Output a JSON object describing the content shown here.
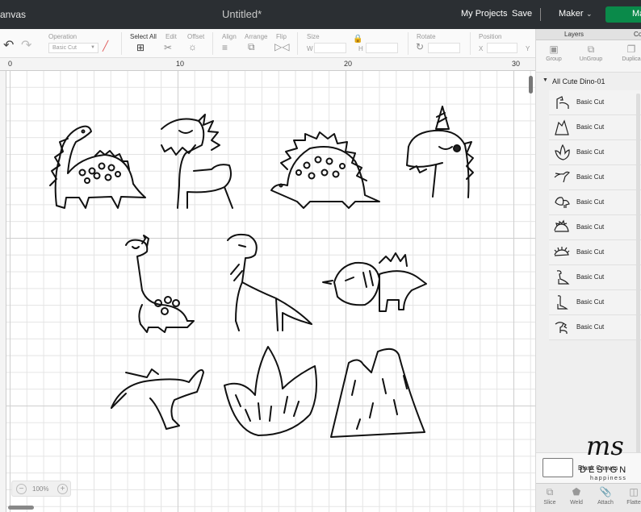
{
  "topbar": {
    "app_title": "anvas",
    "doc_title": "Untitled*",
    "my_projects": "My Projects",
    "save": "Save",
    "machine": "Maker",
    "make": "Ma"
  },
  "toolbar": {
    "operation_label": "Operation",
    "operation_value": "Basic Cut",
    "select_all": "Select All",
    "edit": "Edit",
    "offset": "Offset",
    "align": "Align",
    "arrange": "Arrange",
    "flip": "Flip",
    "size": "Size",
    "size_w": "W",
    "size_h": "H",
    "rotate": "Rotate",
    "position": "Position",
    "pos_x": "X",
    "pos_y": "Y"
  },
  "rulers": {
    "top": [
      "0",
      "10",
      "20",
      "30"
    ]
  },
  "zoom": {
    "value": "100%",
    "minus": "−",
    "plus": "+"
  },
  "panel": {
    "tab_layers": "Layers",
    "tab_color": "Co",
    "actions": [
      "Group",
      "UnGroup",
      "Duplica"
    ],
    "group_name": "All Cute Dino-01",
    "layers": [
      {
        "label": "Basic Cut"
      },
      {
        "label": "Basic Cut"
      },
      {
        "label": "Basic Cut"
      },
      {
        "label": "Basic Cut"
      },
      {
        "label": "Basic Cut"
      },
      {
        "label": "Basic Cut"
      },
      {
        "label": "Basic Cut"
      },
      {
        "label": "Basic Cut"
      },
      {
        "label": "Basic Cut"
      },
      {
        "label": "Basic Cut"
      }
    ],
    "blank_canvas": "Blank Canvas",
    "bottom_actions": [
      "Slice",
      "Weld",
      "Attach",
      "Flatte"
    ]
  },
  "watermark": {
    "script": "ms",
    "design": "DESIGN",
    "tagline": "happiness"
  },
  "colors": {
    "topbar": "#2b2f33",
    "make_button": "#0a8a4a",
    "canvas_grid": "#cfcfcf"
  }
}
